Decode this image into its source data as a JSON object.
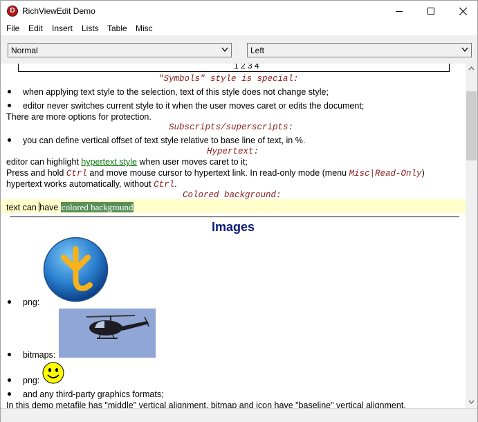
{
  "window": {
    "title": "RichViewEdit Demo",
    "app_icon_letter": "D"
  },
  "menu": [
    "File",
    "Edit",
    "Insert",
    "Lists",
    "Table",
    "Misc"
  ],
  "toolbar": {
    "style_value": "Normal",
    "align_value": "Left"
  },
  "doc": {
    "table_numbers": "1  2  3  4",
    "symbols_heading": "\"Symbols\" style is special:",
    "bullet1": "when applying text style to the selection, text of this style does not change style;",
    "bullet2": "editor never switches current style to it when the user moves caret or edits the document;",
    "protection_line": "There are more options for protection.",
    "subsup_heading": "Subscripts/superscripts:",
    "bullet3": "you can define vertical offset of text style relative to base line of text, in %.",
    "hypertext_heading": "Hypertext:",
    "hl_before": "editor can highlight ",
    "hl_link": "hypertext style",
    "hl_after": " when user moves caret to it;",
    "press_a": "Press and hold ",
    "press_ctrl": "Ctrl",
    "press_b": " and move mouse cursor to hypertext link. In read-only mode (menu ",
    "press_menu": "Misc|Read-Only",
    "press_c": ")",
    "auto_a": "hypertext works automatically, without ",
    "auto_ctrl": "Ctrl",
    "auto_b": ".",
    "colored_heading": "Colored background:",
    "cb_a": "text can ",
    "cb_b": "have ",
    "cb_colored": "colored background",
    "images_title": "Images",
    "png_label": "png:",
    "bitmaps_label": "bitmaps:",
    "png2_label": "png:",
    "any_formats": "and any third-party graphics formats;",
    "metafile_line": "In this demo metafile has \"middle\" vertical alignment, bitmap and icon have \"baseline\" vertical alignment."
  },
  "colors": {
    "heading": "#8b1a1a",
    "link": "#0a7a0a",
    "images_title": "#0a1a7a",
    "highlight_bg": "#ffffcc",
    "colored_bg": "#5a8f5a"
  },
  "icons": [
    "app-icon",
    "minimize-icon",
    "maximize-icon",
    "close-icon",
    "chevron-down-icon",
    "scroll-up-icon",
    "scroll-down-icon"
  ]
}
